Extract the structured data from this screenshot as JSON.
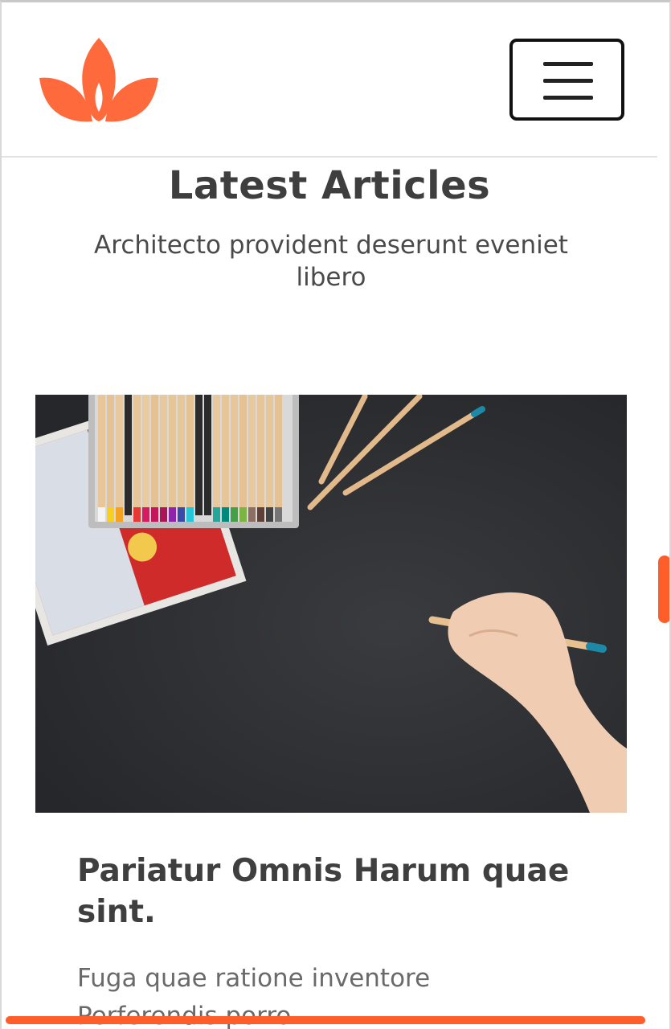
{
  "brand": {
    "accent_color": "#ff6a3d",
    "logo_icon": "lotus-icon"
  },
  "header": {
    "menu_icon": "hamburger-menu-icon"
  },
  "section": {
    "title": "Latest Articles",
    "subtitle": "Architecto provident deserunt eveniet libero"
  },
  "article": {
    "image_icon": "colored-pencils-photo",
    "title": "Pariatur Omnis Harum quae sint.",
    "excerpt": "Fuga quae ratione inventore Perferendis porro"
  },
  "scrollbar": {
    "color": "#ff5e2a"
  }
}
